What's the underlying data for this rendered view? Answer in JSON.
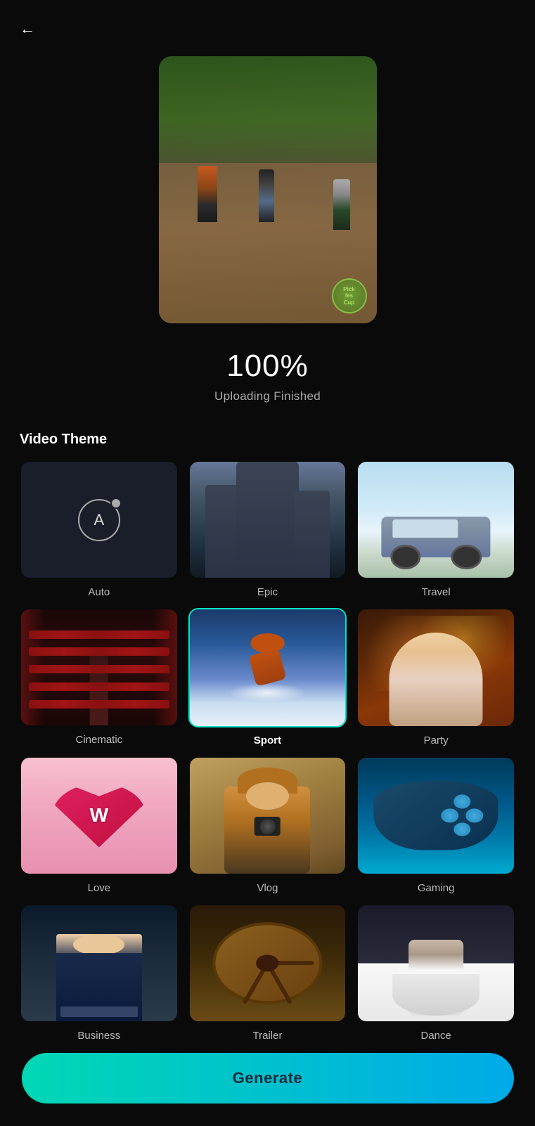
{
  "header": {
    "back_label": "←"
  },
  "upload": {
    "percent": "100%",
    "status": "Uploading Finished"
  },
  "section": {
    "title": "Video Theme"
  },
  "themes": [
    {
      "id": "auto",
      "label": "Auto",
      "selected": false
    },
    {
      "id": "epic",
      "label": "Epic",
      "selected": false
    },
    {
      "id": "travel",
      "label": "Travel",
      "selected": false
    },
    {
      "id": "cinematic",
      "label": "Cinematic",
      "selected": false
    },
    {
      "id": "sport",
      "label": "Sport",
      "selected": true
    },
    {
      "id": "party",
      "label": "Party",
      "selected": false
    },
    {
      "id": "love",
      "label": "Love",
      "selected": false
    },
    {
      "id": "vlog",
      "label": "Vlog",
      "selected": false
    },
    {
      "id": "gaming",
      "label": "Gaming",
      "selected": false
    },
    {
      "id": "business",
      "label": "Business",
      "selected": false
    },
    {
      "id": "trailer",
      "label": "Trailer",
      "selected": false
    },
    {
      "id": "dance",
      "label": "Dance",
      "selected": false
    }
  ],
  "generate_btn": {
    "label": "Generate"
  },
  "watermark": {
    "text": "Pick\nles\nCup"
  }
}
